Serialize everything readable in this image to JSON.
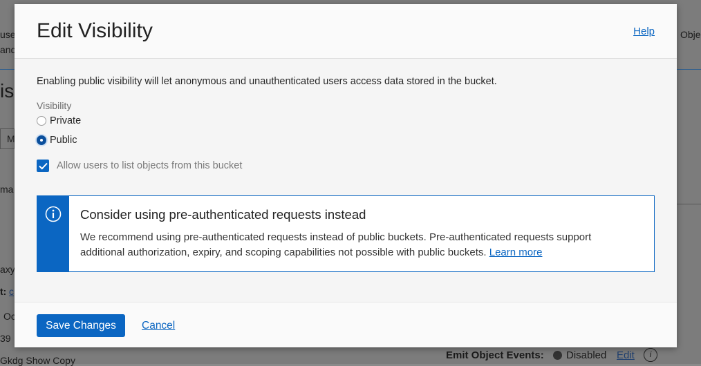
{
  "background": {
    "frag_use": "use",
    "frag_and": "and",
    "frag_obje": "Obje",
    "frag_is": "is",
    "frag_m": "M",
    "frag_ma": "ma",
    "frag_axy": "axy",
    "frag_t": "t:",
    "frag_link": "c",
    "frag_oc": "Oc",
    "frag_39": "39",
    "frag_bottom": "Gkdg  Show  Copy",
    "emit_label": "Emit Object Events:",
    "emit_status": "Disabled",
    "emit_edit": "Edit"
  },
  "modal": {
    "title": "Edit Visibility",
    "help_label": "Help",
    "intro_text": "Enabling public visibility will let anonymous and unauthenticated users access data stored in the bucket.",
    "visibility_label": "Visibility",
    "options": [
      {
        "label": "Private",
        "checked": false
      },
      {
        "label": "Public",
        "checked": true
      }
    ],
    "checkbox_label": "Allow users to list objects from this bucket",
    "info": {
      "title": "Consider using pre-authenticated requests instead",
      "text": "We recommend using pre-authenticated requests instead of public buckets. Pre-authenticated requests support additional authorization, expiry, and scoping capabilities not possible with public buckets.",
      "link": "Learn more"
    },
    "save_label": "Save Changes",
    "cancel_label": "Cancel"
  },
  "colors": {
    "accent": "#0b66c2",
    "radio_selected": "#0b4f9c"
  }
}
